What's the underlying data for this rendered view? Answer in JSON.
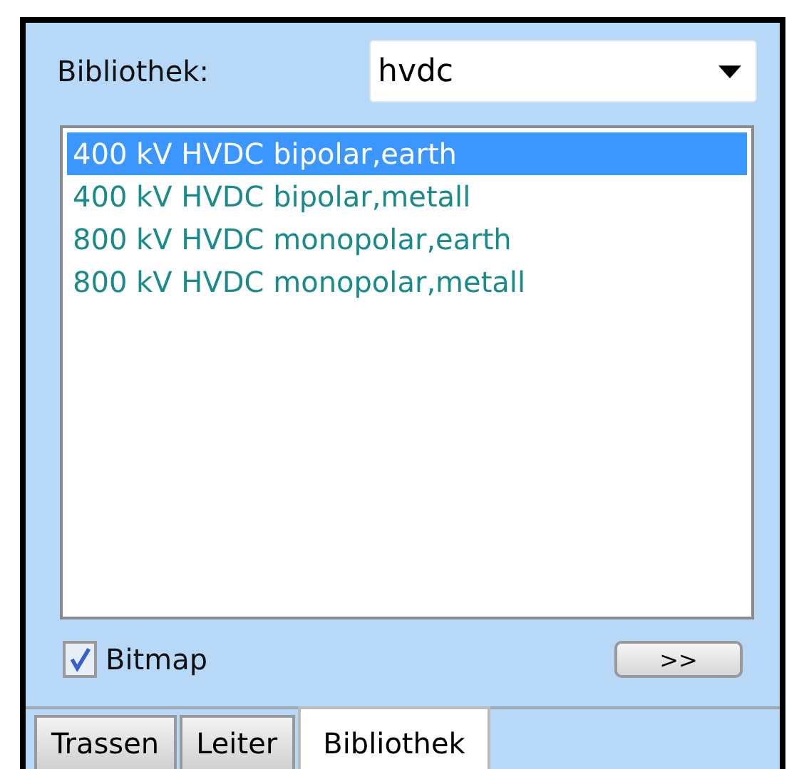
{
  "library_label": "Bibliothek:",
  "library_select": {
    "value": "hvdc"
  },
  "items": [
    {
      "label": "400 kV HVDC bipolar,earth",
      "selected": true
    },
    {
      "label": "400 kV HVDC bipolar,metall",
      "selected": false
    },
    {
      "label": "800 kV HVDC monopolar,earth",
      "selected": false
    },
    {
      "label": "800 kV HVDC monopolar,metall",
      "selected": false
    }
  ],
  "bitmap": {
    "label": "Bitmap",
    "checked": true
  },
  "more_button": ">>",
  "tabs": [
    {
      "label": "Trassen",
      "selected": false
    },
    {
      "label": "Leiter",
      "selected": false
    },
    {
      "label": "Bibliothek",
      "selected": true
    }
  ]
}
